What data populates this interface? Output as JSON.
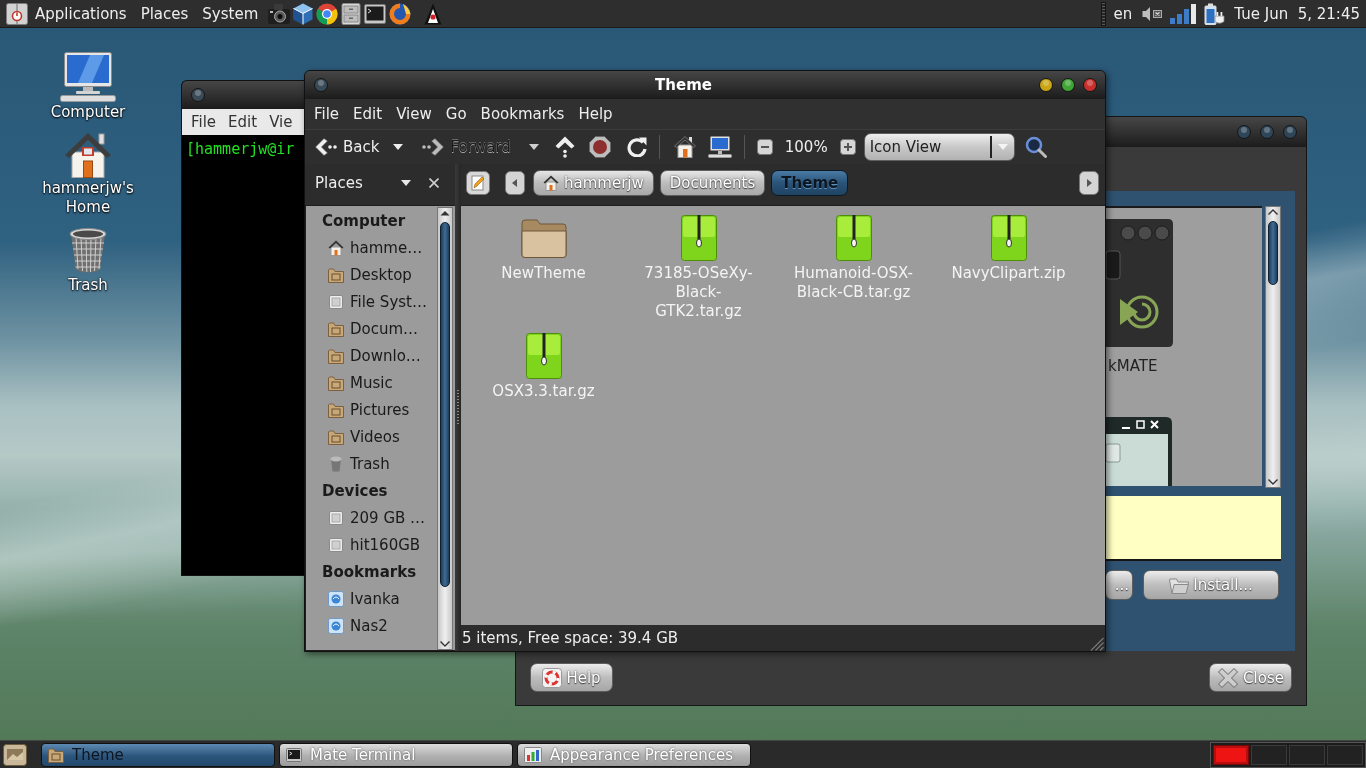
{
  "top_panel": {
    "menus": [
      "Applications",
      "Places",
      "System"
    ],
    "keyboard_layout": "en",
    "clock": "Tue Jun  5, 21:45"
  },
  "desktop_icons": [
    {
      "label": "Computer",
      "kind": "computer"
    },
    {
      "label": "hammerjw's Home",
      "kind": "home"
    },
    {
      "label": "Trash",
      "kind": "trash"
    }
  ],
  "terminal_window": {
    "menus": [
      "File",
      "Edit",
      "Vie"
    ],
    "prompt": "[hammerjw@ir"
  },
  "appearance_window": {
    "theme_label": "kMATE",
    "buttons": [
      {
        "label": "...",
        "kind": "plain"
      },
      {
        "label": "Install...",
        "kind": "folder"
      }
    ],
    "help_button": "Help",
    "close_button": "Close"
  },
  "file_manager": {
    "title": "Theme",
    "menus": [
      "File",
      "Edit",
      "View",
      "Go",
      "Bookmarks",
      "Help"
    ],
    "toolbar": {
      "back": {
        "label": "Back",
        "disabled": false
      },
      "forward": {
        "label": "Forward",
        "disabled": true
      },
      "zoom": "100%",
      "view_mode": "Icon View"
    },
    "sidebar": {
      "title": "Places",
      "sections": [
        {
          "heading": "Computer",
          "items": [
            {
              "label": "hamme…",
              "kind": "home"
            },
            {
              "label": "Desktop",
              "kind": "folder"
            },
            {
              "label": "File Syst…",
              "kind": "drive"
            },
            {
              "label": "Docum…",
              "kind": "folder"
            },
            {
              "label": "Downlo…",
              "kind": "folder"
            },
            {
              "label": "Music",
              "kind": "folder"
            },
            {
              "label": "Pictures",
              "kind": "folder"
            },
            {
              "label": "Videos",
              "kind": "folder"
            },
            {
              "label": "Trash",
              "kind": "trash"
            }
          ]
        },
        {
          "heading": "Devices",
          "items": [
            {
              "label": "209 GB …",
              "kind": "drive"
            },
            {
              "label": "hit160GB",
              "kind": "drive"
            }
          ]
        },
        {
          "heading": "Bookmarks",
          "items": [
            {
              "label": "Ivanka",
              "kind": "network"
            },
            {
              "label": "Nas2",
              "kind": "network"
            }
          ]
        }
      ]
    },
    "path": [
      {
        "label": "hammerjw",
        "selected": false
      },
      {
        "label": "Documents",
        "selected": false
      },
      {
        "label": "Theme",
        "selected": true
      }
    ],
    "files": [
      {
        "name": "NewTheme",
        "kind": "folder"
      },
      {
        "name": "73185-OSeXy-Black-GTK2.tar.gz",
        "kind": "archive"
      },
      {
        "name": "Humanoid-OSX-Black-CB.tar.gz",
        "kind": "archive"
      },
      {
        "name": "NavyClipart.zip",
        "kind": "archive"
      },
      {
        "name": "OSX3.3.tar.gz",
        "kind": "archive"
      }
    ],
    "status": "5 items, Free space: 39.4 GB"
  },
  "taskbar": {
    "tasks": [
      {
        "label": "Theme",
        "selected": true,
        "kind": "folder"
      },
      {
        "label": "Mate Terminal",
        "selected": false,
        "kind": "terminal"
      },
      {
        "label": "Appearance Preferences",
        "selected": false,
        "kind": "appearance"
      }
    ],
    "workspaces": [
      {
        "selected": true
      },
      {
        "selected": false
      },
      {
        "selected": false
      },
      {
        "selected": false
      }
    ]
  }
}
